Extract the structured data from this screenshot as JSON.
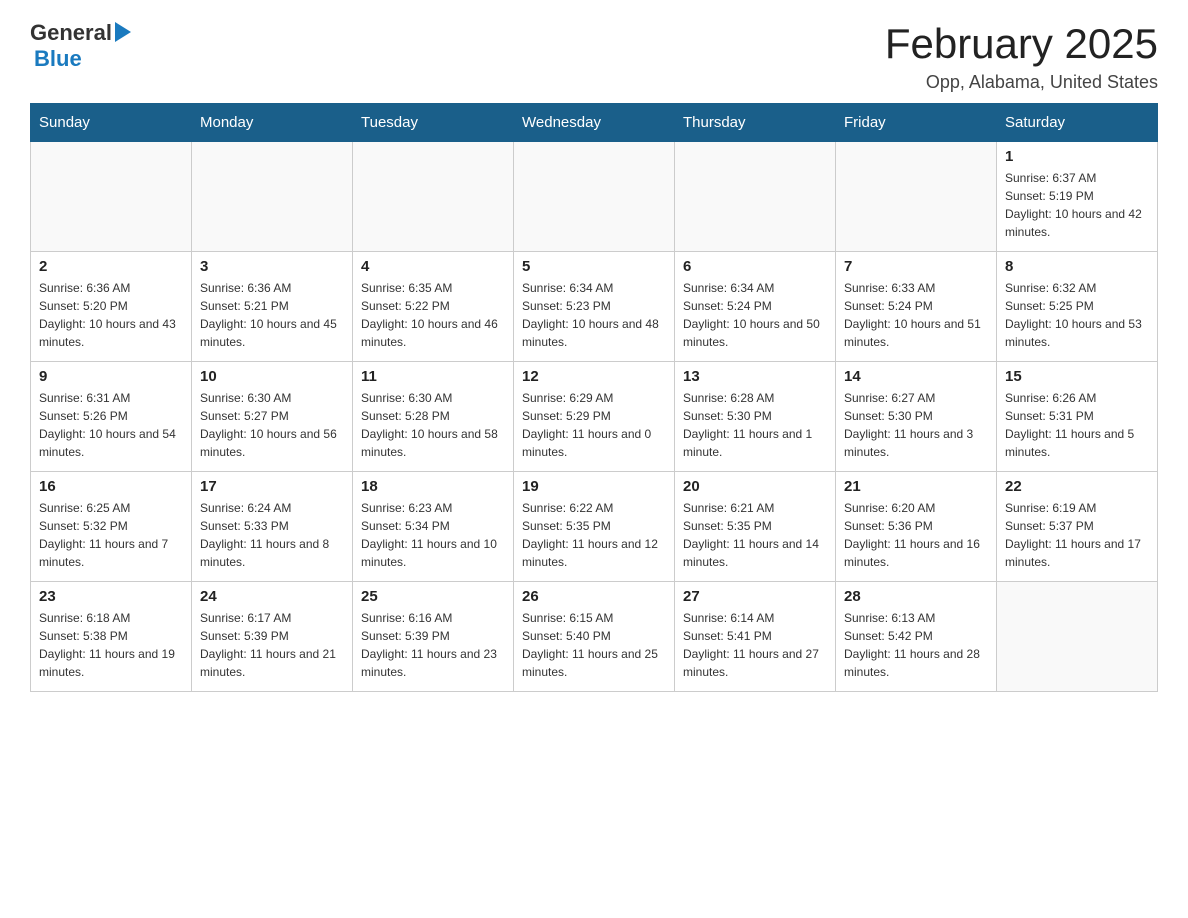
{
  "header": {
    "logo": {
      "general": "General",
      "blue": "Blue"
    },
    "title": "February 2025",
    "location": "Opp, Alabama, United States"
  },
  "calendar": {
    "days_of_week": [
      "Sunday",
      "Monday",
      "Tuesday",
      "Wednesday",
      "Thursday",
      "Friday",
      "Saturday"
    ],
    "weeks": [
      [
        {
          "day": "",
          "info": ""
        },
        {
          "day": "",
          "info": ""
        },
        {
          "day": "",
          "info": ""
        },
        {
          "day": "",
          "info": ""
        },
        {
          "day": "",
          "info": ""
        },
        {
          "day": "",
          "info": ""
        },
        {
          "day": "1",
          "info": "Sunrise: 6:37 AM\nSunset: 5:19 PM\nDaylight: 10 hours and 42 minutes."
        }
      ],
      [
        {
          "day": "2",
          "info": "Sunrise: 6:36 AM\nSunset: 5:20 PM\nDaylight: 10 hours and 43 minutes."
        },
        {
          "day": "3",
          "info": "Sunrise: 6:36 AM\nSunset: 5:21 PM\nDaylight: 10 hours and 45 minutes."
        },
        {
          "day": "4",
          "info": "Sunrise: 6:35 AM\nSunset: 5:22 PM\nDaylight: 10 hours and 46 minutes."
        },
        {
          "day": "5",
          "info": "Sunrise: 6:34 AM\nSunset: 5:23 PM\nDaylight: 10 hours and 48 minutes."
        },
        {
          "day": "6",
          "info": "Sunrise: 6:34 AM\nSunset: 5:24 PM\nDaylight: 10 hours and 50 minutes."
        },
        {
          "day": "7",
          "info": "Sunrise: 6:33 AM\nSunset: 5:24 PM\nDaylight: 10 hours and 51 minutes."
        },
        {
          "day": "8",
          "info": "Sunrise: 6:32 AM\nSunset: 5:25 PM\nDaylight: 10 hours and 53 minutes."
        }
      ],
      [
        {
          "day": "9",
          "info": "Sunrise: 6:31 AM\nSunset: 5:26 PM\nDaylight: 10 hours and 54 minutes."
        },
        {
          "day": "10",
          "info": "Sunrise: 6:30 AM\nSunset: 5:27 PM\nDaylight: 10 hours and 56 minutes."
        },
        {
          "day": "11",
          "info": "Sunrise: 6:30 AM\nSunset: 5:28 PM\nDaylight: 10 hours and 58 minutes."
        },
        {
          "day": "12",
          "info": "Sunrise: 6:29 AM\nSunset: 5:29 PM\nDaylight: 11 hours and 0 minutes."
        },
        {
          "day": "13",
          "info": "Sunrise: 6:28 AM\nSunset: 5:30 PM\nDaylight: 11 hours and 1 minute."
        },
        {
          "day": "14",
          "info": "Sunrise: 6:27 AM\nSunset: 5:30 PM\nDaylight: 11 hours and 3 minutes."
        },
        {
          "day": "15",
          "info": "Sunrise: 6:26 AM\nSunset: 5:31 PM\nDaylight: 11 hours and 5 minutes."
        }
      ],
      [
        {
          "day": "16",
          "info": "Sunrise: 6:25 AM\nSunset: 5:32 PM\nDaylight: 11 hours and 7 minutes."
        },
        {
          "day": "17",
          "info": "Sunrise: 6:24 AM\nSunset: 5:33 PM\nDaylight: 11 hours and 8 minutes."
        },
        {
          "day": "18",
          "info": "Sunrise: 6:23 AM\nSunset: 5:34 PM\nDaylight: 11 hours and 10 minutes."
        },
        {
          "day": "19",
          "info": "Sunrise: 6:22 AM\nSunset: 5:35 PM\nDaylight: 11 hours and 12 minutes."
        },
        {
          "day": "20",
          "info": "Sunrise: 6:21 AM\nSunset: 5:35 PM\nDaylight: 11 hours and 14 minutes."
        },
        {
          "day": "21",
          "info": "Sunrise: 6:20 AM\nSunset: 5:36 PM\nDaylight: 11 hours and 16 minutes."
        },
        {
          "day": "22",
          "info": "Sunrise: 6:19 AM\nSunset: 5:37 PM\nDaylight: 11 hours and 17 minutes."
        }
      ],
      [
        {
          "day": "23",
          "info": "Sunrise: 6:18 AM\nSunset: 5:38 PM\nDaylight: 11 hours and 19 minutes."
        },
        {
          "day": "24",
          "info": "Sunrise: 6:17 AM\nSunset: 5:39 PM\nDaylight: 11 hours and 21 minutes."
        },
        {
          "day": "25",
          "info": "Sunrise: 6:16 AM\nSunset: 5:39 PM\nDaylight: 11 hours and 23 minutes."
        },
        {
          "day": "26",
          "info": "Sunrise: 6:15 AM\nSunset: 5:40 PM\nDaylight: 11 hours and 25 minutes."
        },
        {
          "day": "27",
          "info": "Sunrise: 6:14 AM\nSunset: 5:41 PM\nDaylight: 11 hours and 27 minutes."
        },
        {
          "day": "28",
          "info": "Sunrise: 6:13 AM\nSunset: 5:42 PM\nDaylight: 11 hours and 28 minutes."
        },
        {
          "day": "",
          "info": ""
        }
      ]
    ]
  }
}
